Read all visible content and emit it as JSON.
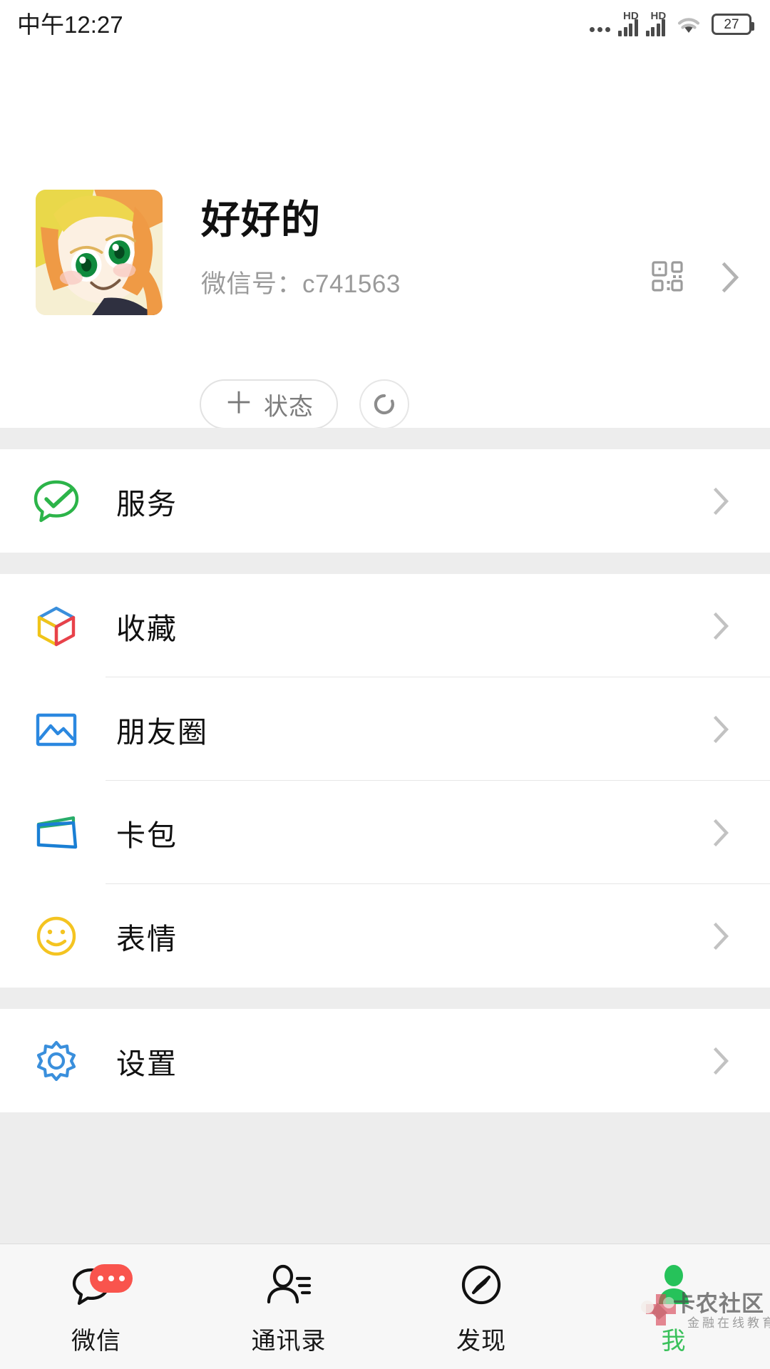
{
  "statusbar": {
    "time": "中午12:27",
    "dots_icon": "more-dots-icon",
    "sim1_label": "HD",
    "sim2_label": "HD",
    "wifi_icon": "wifi-icon",
    "battery_level": "27"
  },
  "profile": {
    "avatar_alt": "anime-girl-avatar",
    "nickname": "好好的",
    "wxid_label": "微信号：",
    "wxid_value": "c741563",
    "wxid_full": "微信号：c741563",
    "qr_icon": "qr-code-icon",
    "chevron_icon": "chevron-right-icon",
    "status_button": {
      "plus": "＋",
      "label": "状态"
    },
    "refresh_icon": "refresh-circle-icon"
  },
  "menu_groups": [
    {
      "items": [
        {
          "label": "服务",
          "icon": "services-bubble-check-icon",
          "color": "#3ab75a",
          "arrow": "chevron-right-icon"
        }
      ]
    },
    {
      "items": [
        {
          "label": "收藏",
          "icon": "favorites-cube-icon",
          "color": "#3a8fdc",
          "arrow": "chevron-right-icon"
        },
        {
          "label": "朋友圈",
          "icon": "moments-photo-icon",
          "color": "#2b88e0",
          "arrow": "chevron-right-icon"
        },
        {
          "label": "卡包",
          "icon": "cards-wallet-icon",
          "color": "#1a7fd4",
          "arrow": "chevron-right-icon"
        },
        {
          "label": "表情",
          "icon": "stickers-smiley-icon",
          "color": "#f4c421",
          "arrow": "chevron-right-icon"
        }
      ]
    },
    {
      "items": [
        {
          "label": "设置",
          "icon": "settings-gear-icon",
          "color": "#3a8fdc",
          "arrow": "chevron-right-icon"
        }
      ]
    }
  ],
  "tabbar": {
    "items": [
      {
        "label": "微信",
        "icon": "chat-bubble-icon",
        "active": false,
        "badge": "•••"
      },
      {
        "label": "通讯录",
        "icon": "contacts-icon",
        "active": false,
        "badge": ""
      },
      {
        "label": "发现",
        "icon": "compass-icon",
        "active": false,
        "badge": ""
      },
      {
        "label": "我",
        "icon": "profile-person-icon",
        "active": true,
        "badge": ""
      }
    ],
    "active_color": "#3ac15b",
    "badge_color": "#f9544d"
  },
  "watermark": {
    "main": "卡农社区",
    "sub": "金融在线教育"
  }
}
